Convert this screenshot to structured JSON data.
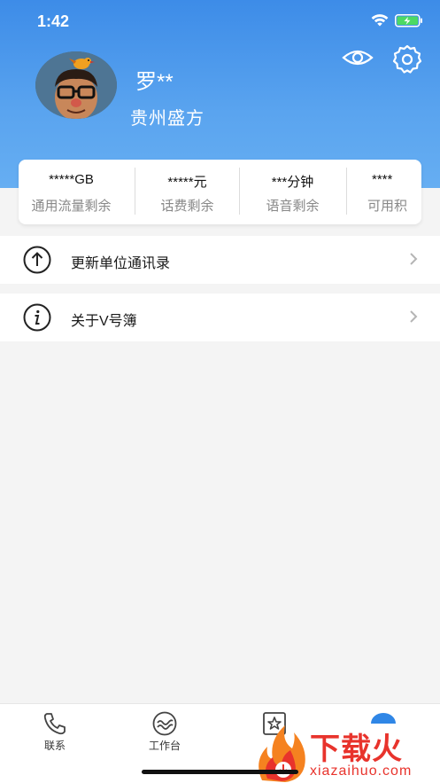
{
  "status_bar": {
    "time": "1:42"
  },
  "profile": {
    "name": "罗**",
    "organization": "贵州盛方"
  },
  "stats": [
    {
      "value": "*****GB",
      "label": "通用流量剩余"
    },
    {
      "value": "*****元",
      "label": "话费剩余"
    },
    {
      "value": "***分钟",
      "label": "语音剩余"
    },
    {
      "value": "****",
      "label": "可用积"
    }
  ],
  "menu": [
    {
      "label": "更新单位通讯录",
      "icon": "upload-circle-icon"
    },
    {
      "label": "关于V号簿",
      "icon": "info-circle-icon"
    }
  ],
  "tabs": [
    {
      "label": "联系",
      "icon": "phone-icon"
    },
    {
      "label": "工作台",
      "icon": "workbench-icon"
    },
    {
      "label": "",
      "icon": "star-card-icon"
    },
    {
      "label": "",
      "icon": "profile-icon"
    }
  ],
  "watermark": {
    "text": "下载火",
    "sub": "xiazaihuo.com"
  },
  "colors": {
    "header": "#3d8ce8",
    "accent": "#2f86e6",
    "watermark": "#e8332c"
  }
}
